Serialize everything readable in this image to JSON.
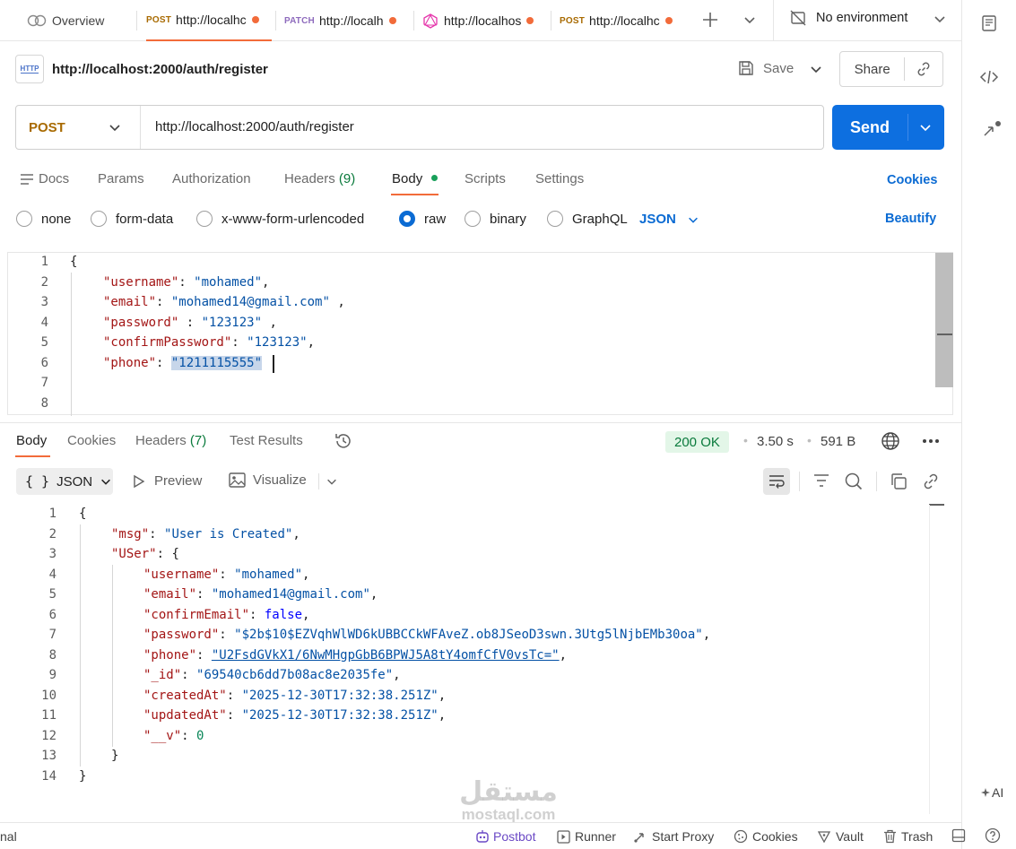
{
  "tabs": [
    {
      "label": "Overview",
      "method": ""
    },
    {
      "label": "http://localhc",
      "method": "POST"
    },
    {
      "label": "PATCH",
      "url": "http://localh"
    },
    {
      "label": "http://localhos",
      "method": ""
    },
    {
      "label": "http://localhc",
      "method": "POST"
    }
  ],
  "environment": {
    "label": "No environment"
  },
  "request": {
    "badge": "HTTP",
    "title": "http://localhost:2000/auth/register",
    "save_label": "Save",
    "share_label": "Share",
    "method": "POST",
    "url": "http://localhost:2000/auth/register",
    "send_label": "Send"
  },
  "request_tabs": {
    "docs": "Docs",
    "params": "Params",
    "authorization": "Authorization",
    "headers": "Headers",
    "headers_count": "(9)",
    "body": "Body",
    "scripts": "Scripts",
    "settings": "Settings",
    "cookies": "Cookies"
  },
  "body_types": {
    "none": "none",
    "form_data": "form-data",
    "urlencoded": "x-www-form-urlencoded",
    "raw": "raw",
    "binary": "binary",
    "graphql": "GraphQL",
    "format": "JSON",
    "beautify": "Beautify"
  },
  "request_body": {
    "line_numbers": [
      "1",
      "2",
      "3",
      "4",
      "5",
      "6",
      "7",
      "8"
    ],
    "open_brace": "{",
    "fields": [
      {
        "key": "\"username\"",
        "sep": ": ",
        "value": "\"mohamed\"",
        "end": ","
      },
      {
        "key": "\"email\"",
        "sep": ": ",
        "value": "\"mohamed14@gmail.com\"",
        "end": " ,"
      },
      {
        "key": "\"password\"",
        "sep": " : ",
        "value": "\"123123\"",
        "end": " ,"
      },
      {
        "key": "\"confirmPassword\"",
        "sep": ": ",
        "value": "\"123123\"",
        "end": ","
      },
      {
        "key": "\"phone\"",
        "sep": ": ",
        "value": "\"1211115555\"",
        "end": ""
      }
    ]
  },
  "response_tabs": {
    "body": "Body",
    "cookies": "Cookies",
    "headers": "Headers",
    "headers_count": "(7)",
    "test_results": "Test Results"
  },
  "response_meta": {
    "status": "200 OK",
    "time": "3.50 s",
    "size": "591 B",
    "status_color": "#0a7a3c"
  },
  "response_toolbar": {
    "format_icon": "{ }",
    "format": "JSON",
    "preview": "Preview",
    "visualize": "Visualize"
  },
  "response_body": {
    "line_numbers": [
      "1",
      "2",
      "3",
      "4",
      "5",
      "6",
      "7",
      "8",
      "9",
      "10",
      "11",
      "12",
      "13",
      "14"
    ],
    "open_brace": "{",
    "msg_key": "\"msg\"",
    "msg_value": "\"User is Created\"",
    "user_key": "\"USer\"",
    "user_open": "{",
    "user_fields": [
      {
        "key": "\"username\"",
        "value": "\"mohamed\"",
        "kind": "str",
        "end": ","
      },
      {
        "key": "\"email\"",
        "value": "\"mohamed14@gmail.com\"",
        "kind": "str",
        "end": ","
      },
      {
        "key": "\"confirmEmail\"",
        "value": "false",
        "kind": "bool",
        "end": ","
      },
      {
        "key": "\"password\"",
        "value": "\"$2b$10$EZVqhWlWD6kUBBCCkWFAveZ.ob8JSeoD3swn.3Utg5lNjbEMb30oa\"",
        "kind": "str",
        "end": ","
      },
      {
        "key": "\"phone\"",
        "value": "\"U2FsdGVkX1/6NwMHgpGbB6BPWJ5A8tY4omfCfV0vsTc=\"",
        "kind": "str",
        "end": ","
      },
      {
        "key": "\"_id\"",
        "value": "\"69540cb6dd7b08ac8e2035fe\"",
        "kind": "str",
        "end": ","
      },
      {
        "key": "\"createdAt\"",
        "value": "\"2025-12-30T17:32:38.251Z\"",
        "kind": "str",
        "end": ","
      },
      {
        "key": "\"updatedAt\"",
        "value": "\"2025-12-30T17:32:38.251Z\"",
        "kind": "str",
        "end": ","
      },
      {
        "key": "\"__v\"",
        "value": "0",
        "kind": "num",
        "end": ""
      }
    ],
    "user_close": "}",
    "close_brace": "}"
  },
  "watermark": {
    "arabic": "مستقل",
    "latin": "mostaql.com"
  },
  "status_bar": {
    "left": "nal",
    "postbot": "Postbot",
    "runner": "Runner",
    "start_proxy": "Start Proxy",
    "cookies": "Cookies",
    "vault": "Vault",
    "trash": "Trash"
  },
  "rail": {
    "ai_label": "AI"
  },
  "colors": {
    "accent": "#0b6bd3",
    "send": "#0d6fe0",
    "post_method": "#a86a00",
    "patch_method": "#8e6bbd",
    "unsaved_dot": "#f26b3a",
    "status_bg": "#e3f6e8"
  }
}
